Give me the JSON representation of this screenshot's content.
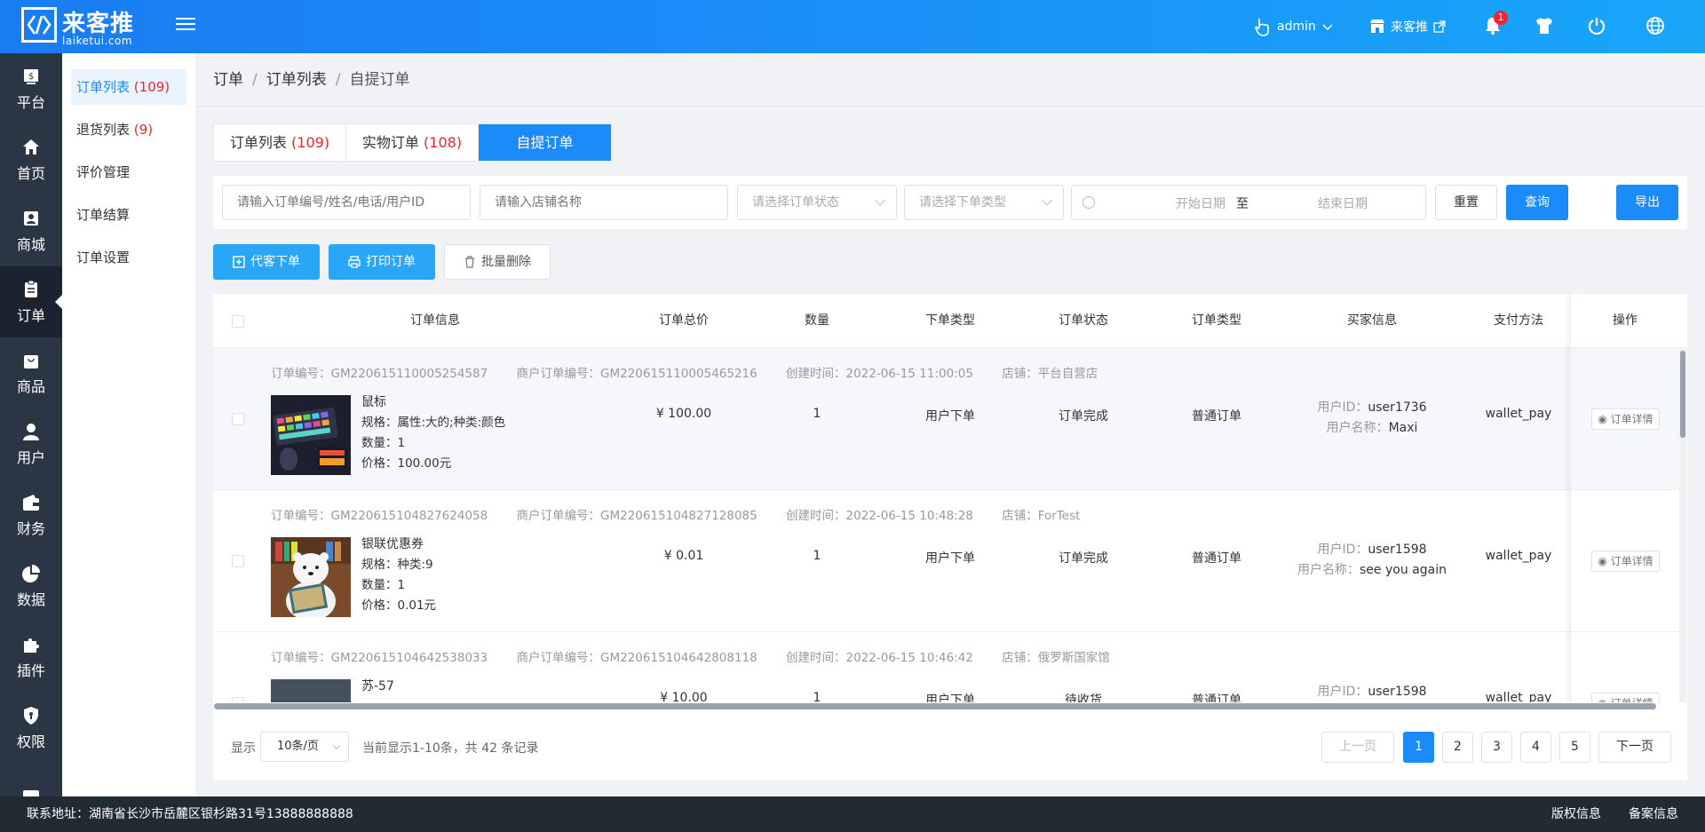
{
  "brand": {
    "name_cn": "来客推",
    "name_en": "laiketui.com"
  },
  "header": {
    "user": "admin",
    "shop": "来客推",
    "notification_count": "1"
  },
  "sidebar": [
    {
      "label": "平台",
      "icon": "platform-icon"
    },
    {
      "label": "首页",
      "icon": "home-icon"
    },
    {
      "label": "商城",
      "icon": "store-icon"
    },
    {
      "label": "订单",
      "icon": "order-icon",
      "active": true
    },
    {
      "label": "商品",
      "icon": "goods-icon"
    },
    {
      "label": "用户",
      "icon": "user-icon"
    },
    {
      "label": "财务",
      "icon": "wallet-icon"
    },
    {
      "label": "数据",
      "icon": "chart-icon"
    },
    {
      "label": "插件",
      "icon": "puzzle-icon"
    },
    {
      "label": "权限",
      "icon": "shield-icon"
    },
    {
      "label": "",
      "icon": "image-icon"
    }
  ],
  "submenu": [
    {
      "label": "订单列表",
      "count": "(109)"
    },
    {
      "label": "退货列表",
      "count": "(9)"
    },
    {
      "label": "评价管理",
      "count": ""
    },
    {
      "label": "订单结算",
      "count": ""
    },
    {
      "label": "订单设置",
      "count": ""
    }
  ],
  "breadcrumb": [
    "订单",
    "订单列表",
    "自提订单"
  ],
  "tabs": [
    {
      "label": "订单列表",
      "count": "(109)"
    },
    {
      "label": "实物订单",
      "count": "(108)"
    },
    {
      "label": "自提订单",
      "count": ""
    }
  ],
  "filters": {
    "order_search_placeholder": "请输入订单编号/姓名/电话/用户ID",
    "store_search_placeholder": "请输入店铺名称",
    "status_placeholder": "请选择订单状态",
    "type_placeholder": "请选择下单类型",
    "start_date": "开始日期",
    "date_sep": "至",
    "end_date": "结束日期",
    "reset": "重置",
    "query": "查询",
    "export": "导出"
  },
  "actions": {
    "proxy_order": "代客下单",
    "print_order": "打印订单",
    "batch_delete": "批量删除"
  },
  "table": {
    "headers": [
      "订单信息",
      "订单总价",
      "数量",
      "下单类型",
      "订单状态",
      "订单类型",
      "买家信息",
      "支付方法",
      "操作"
    ],
    "label_order_no": "订单编号：",
    "label_merchant_no": "商户订单编号：",
    "label_created": "创建时间：",
    "label_store": "店铺：",
    "label_spec": "规格：",
    "label_qty": "数量：",
    "label_price": "价格：",
    "label_user_id": "用户ID：",
    "label_user_name": "用户名称：",
    "detail_btn": "订单详情",
    "rows": [
      {
        "order_no": "GM220615110005254587",
        "merchant_no": "GM220615110005465216",
        "created": "2022-06-15 11:00:05",
        "store": "平台自营店",
        "product": "鼠标",
        "spec": "属性:大的;种类:颜色",
        "qty": "1",
        "price": "100.00元",
        "total": "¥ 100.00",
        "count": "1",
        "order_kind": "用户下单",
        "status": "订单完成",
        "type": "普通订单",
        "user_id": "user1736",
        "user_name": "Maxi",
        "pay": "wallet_pay"
      },
      {
        "order_no": "GM220615104827624058",
        "merchant_no": "GM220615104827128085",
        "created": "2022-06-15 10:48:28",
        "store": "ForTest",
        "product": "银联优惠券",
        "spec": "种类:9",
        "qty": "1",
        "price": "0.01元",
        "total": "¥ 0.01",
        "count": "1",
        "order_kind": "用户下单",
        "status": "订单完成",
        "type": "普通订单",
        "user_id": "user1598",
        "user_name": "see you again",
        "pay": "wallet_pay"
      },
      {
        "order_no": "GM220615104642538033",
        "merchant_no": "GM220615104642808118",
        "created": "2022-06-15 10:46:42",
        "store": "俄罗斯国家馆",
        "product": "苏-57",
        "spec": "",
        "qty": "",
        "price": "",
        "total": "¥ 10.00",
        "count": "1",
        "order_kind": "用户下单",
        "status": "待收货",
        "type": "普通订单",
        "user_id": "user1598",
        "user_name": "",
        "pay": "wallet_pay"
      }
    ]
  },
  "pagination": {
    "show_label": "显示",
    "page_size": "10条/页",
    "info": "当前显示1-10条，共 42 条记录",
    "prev": "上一页",
    "pages": [
      "1",
      "2",
      "3",
      "4",
      "5"
    ],
    "next": "下一页"
  },
  "footer": {
    "address": "联系地址：湖南省长沙市岳麓区银杉路31号13888888888",
    "copyright": "版权信息",
    "icp": "备案信息"
  }
}
